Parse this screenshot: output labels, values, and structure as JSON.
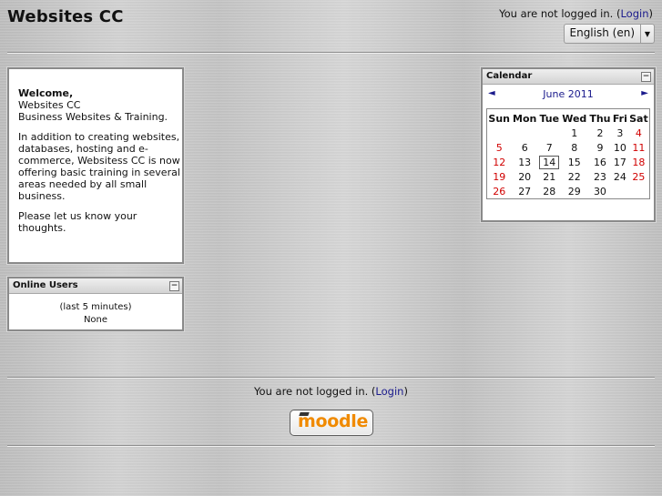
{
  "header": {
    "site_title": "Websites CC",
    "login_prefix": "You are not logged in. (",
    "login_link": "Login",
    "login_suffix": ")",
    "language": "English (en)"
  },
  "welcome_block": {
    "greeting": "Welcome,",
    "line2": "Websites CC",
    "line3": "Business Websites & Training.",
    "para2": "In addition to creating websites, databases, hosting and e-commerce, Websitess CC is now offering basic training in several areas needed by all small business.",
    "para3": "Please let us know your thoughts."
  },
  "online_users": {
    "title": "Online Users",
    "period": "(last 5 minutes)",
    "value": "None"
  },
  "calendar": {
    "title": "Calendar",
    "month": "June 2011",
    "prev": "◄",
    "next": "►",
    "days": [
      "Sun",
      "Mon",
      "Tue",
      "Wed",
      "Thu",
      "Fri",
      "Sat"
    ],
    "weeks": [
      [
        "",
        "",
        "",
        "1",
        "2",
        "3",
        "4"
      ],
      [
        "5",
        "6",
        "7",
        "8",
        "9",
        "10",
        "11"
      ],
      [
        "12",
        "13",
        "14",
        "15",
        "16",
        "17",
        "18"
      ],
      [
        "19",
        "20",
        "21",
        "22",
        "23",
        "24",
        "25"
      ],
      [
        "26",
        "27",
        "28",
        "29",
        "30",
        "",
        ""
      ]
    ],
    "today": "14",
    "weekend_color": "#d10000"
  },
  "footer": {
    "login_prefix": "You are not logged in. (",
    "login_link": "Login",
    "login_suffix": ")",
    "logo_text": "moodle"
  }
}
